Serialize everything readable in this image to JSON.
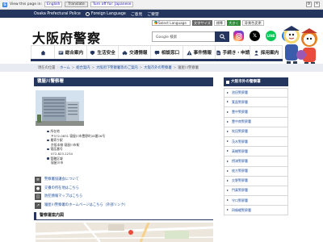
{
  "translate_bar": {
    "view_label": "View this page in:",
    "language": "English",
    "translate_button": "Translate",
    "option_text": "Turn off for: Japanese"
  },
  "topbar": {
    "site_name": "Osaka Prefectural Police",
    "lang_label": "Foreign Language",
    "links": [
      "ご意見",
      "ご要望"
    ]
  },
  "header": {
    "title": "大阪府警察",
    "tools": {
      "select_language": "Select Language",
      "buttons": [
        "文字サイズ",
        "標準",
        "大きく",
        "背景色変更"
      ]
    },
    "search": {
      "value": "Google 検索",
      "button_icon": "search-icon"
    },
    "social": [
      "instagram-icon",
      "x-icon",
      "line-icon",
      "facebook-icon"
    ]
  },
  "nav": {
    "items": [
      {
        "label": "",
        "icon": "home-icon"
      },
      {
        "label": "総合案内",
        "icon": "info-icon"
      },
      {
        "label": "生活安全",
        "icon": "shield-icon"
      },
      {
        "label": "交通情報",
        "icon": "car-icon"
      },
      {
        "label": "相談窓口",
        "icon": "chat-icon"
      },
      {
        "label": "事件情報",
        "icon": "alert-icon"
      },
      {
        "label": "手続き・申請",
        "icon": "document-icon"
      },
      {
        "label": "採用案内",
        "icon": "person-icon"
      }
    ]
  },
  "breadcrumb": {
    "prefix": "現在の位置",
    "items": [
      "ホーム",
      "総合案内",
      "大阪府下警察署等のご案内",
      "大阪市外の警察署",
      "寝屋川警察署"
    ]
  },
  "page": {
    "title": "寝屋川警察署",
    "info": {
      "location_label": "所在地",
      "postal": "〒572-0831 寝屋川市豊野町28番26号",
      "access_label": "最寄り駅",
      "access_value": "京阪本線 寝屋川市駅",
      "phone_label": "電話番号",
      "phone_value": "072-823-1234",
      "area_label": "管轄区域",
      "area_value": "寝屋川市"
    },
    "links": [
      {
        "text": "警察署協議会について",
        "icon": "document-icon"
      },
      {
        "text": "交番の所在地はこちら",
        "icon": "location-icon"
      },
      {
        "text": "防犯情報マップはこちら",
        "icon": "map-icon"
      },
      {
        "text": "寝屋川警察署のホームページはこちら（外部リンク）",
        "icon": "external-link-icon"
      }
    ],
    "map_title": "警察署案内図"
  },
  "sidebar": {
    "title": "大阪市外の警察署",
    "items": [
      "池田警察署",
      "箕面警察署",
      "豊中警察署",
      "豊中南警察署",
      "吹田警察署",
      "茨木警察署",
      "高槻警察署",
      "摂津警察署",
      "枚方警察署",
      "交野警察署",
      "門真警察署",
      "守口警察署",
      "四條畷警察署"
    ]
  },
  "colors": {
    "primary": "#24365e",
    "link": "#1f4e9c",
    "breadcrumb_bg": "#e8ecf2"
  }
}
